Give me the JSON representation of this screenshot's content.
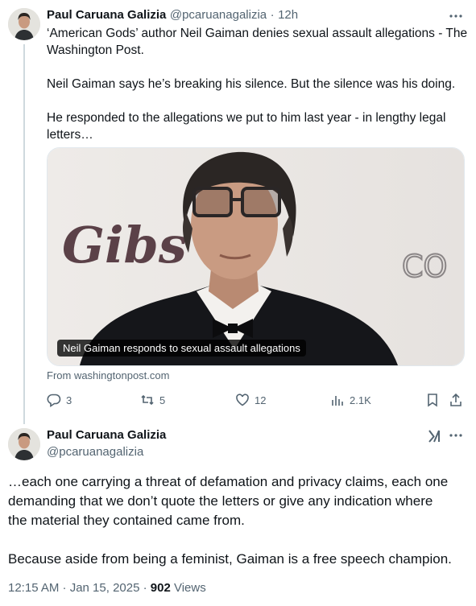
{
  "tweet1": {
    "author_name": "Paul Caruana Galizia",
    "handle": "@pcaruanagalizia",
    "separator": "·",
    "time": "12h",
    "more_icon": "more-horizontal-icon",
    "lines": [
      "‘American Gods’ author Neil Gaiman denies sexual assault allegations - The",
      "Washington Post.",
      "Neil Gaiman says he’s breaking his silence. But the silence was his doing.",
      "He responded to the allegations we put to him last year - in lengthy legal",
      "letters…"
    ],
    "card": {
      "caption": "Neil Gaiman responds to sexual assault allegations",
      "backdrop_text_left": "Gibs",
      "backdrop_text_right": "CO",
      "source": "From washingtonpost.com"
    },
    "actions": {
      "replies": "3",
      "reposts": "5",
      "likes": "12",
      "views": "2.1K"
    }
  },
  "tweet2": {
    "author_name": "Paul Caruana Galizia",
    "handle": "@pcaruanagalizia",
    "grok_icon": "grok-icon",
    "more_icon": "more-horizontal-icon",
    "lines": [
      "…each one carrying a threat of defamation and privacy claims, each one",
      "demanding that we don’t quote the letters or give any indication where",
      "the material they contained came from.",
      "Because aside from being a feminist, Gaiman is a free speech champion."
    ],
    "timestamp": "12:15 AM · Jan 15, 2025 · ",
    "views_count": "902",
    "views_label": " Views"
  },
  "colors": {
    "text": "#0f1419",
    "muted": "#536471",
    "thread_line": "#cfd9de"
  }
}
